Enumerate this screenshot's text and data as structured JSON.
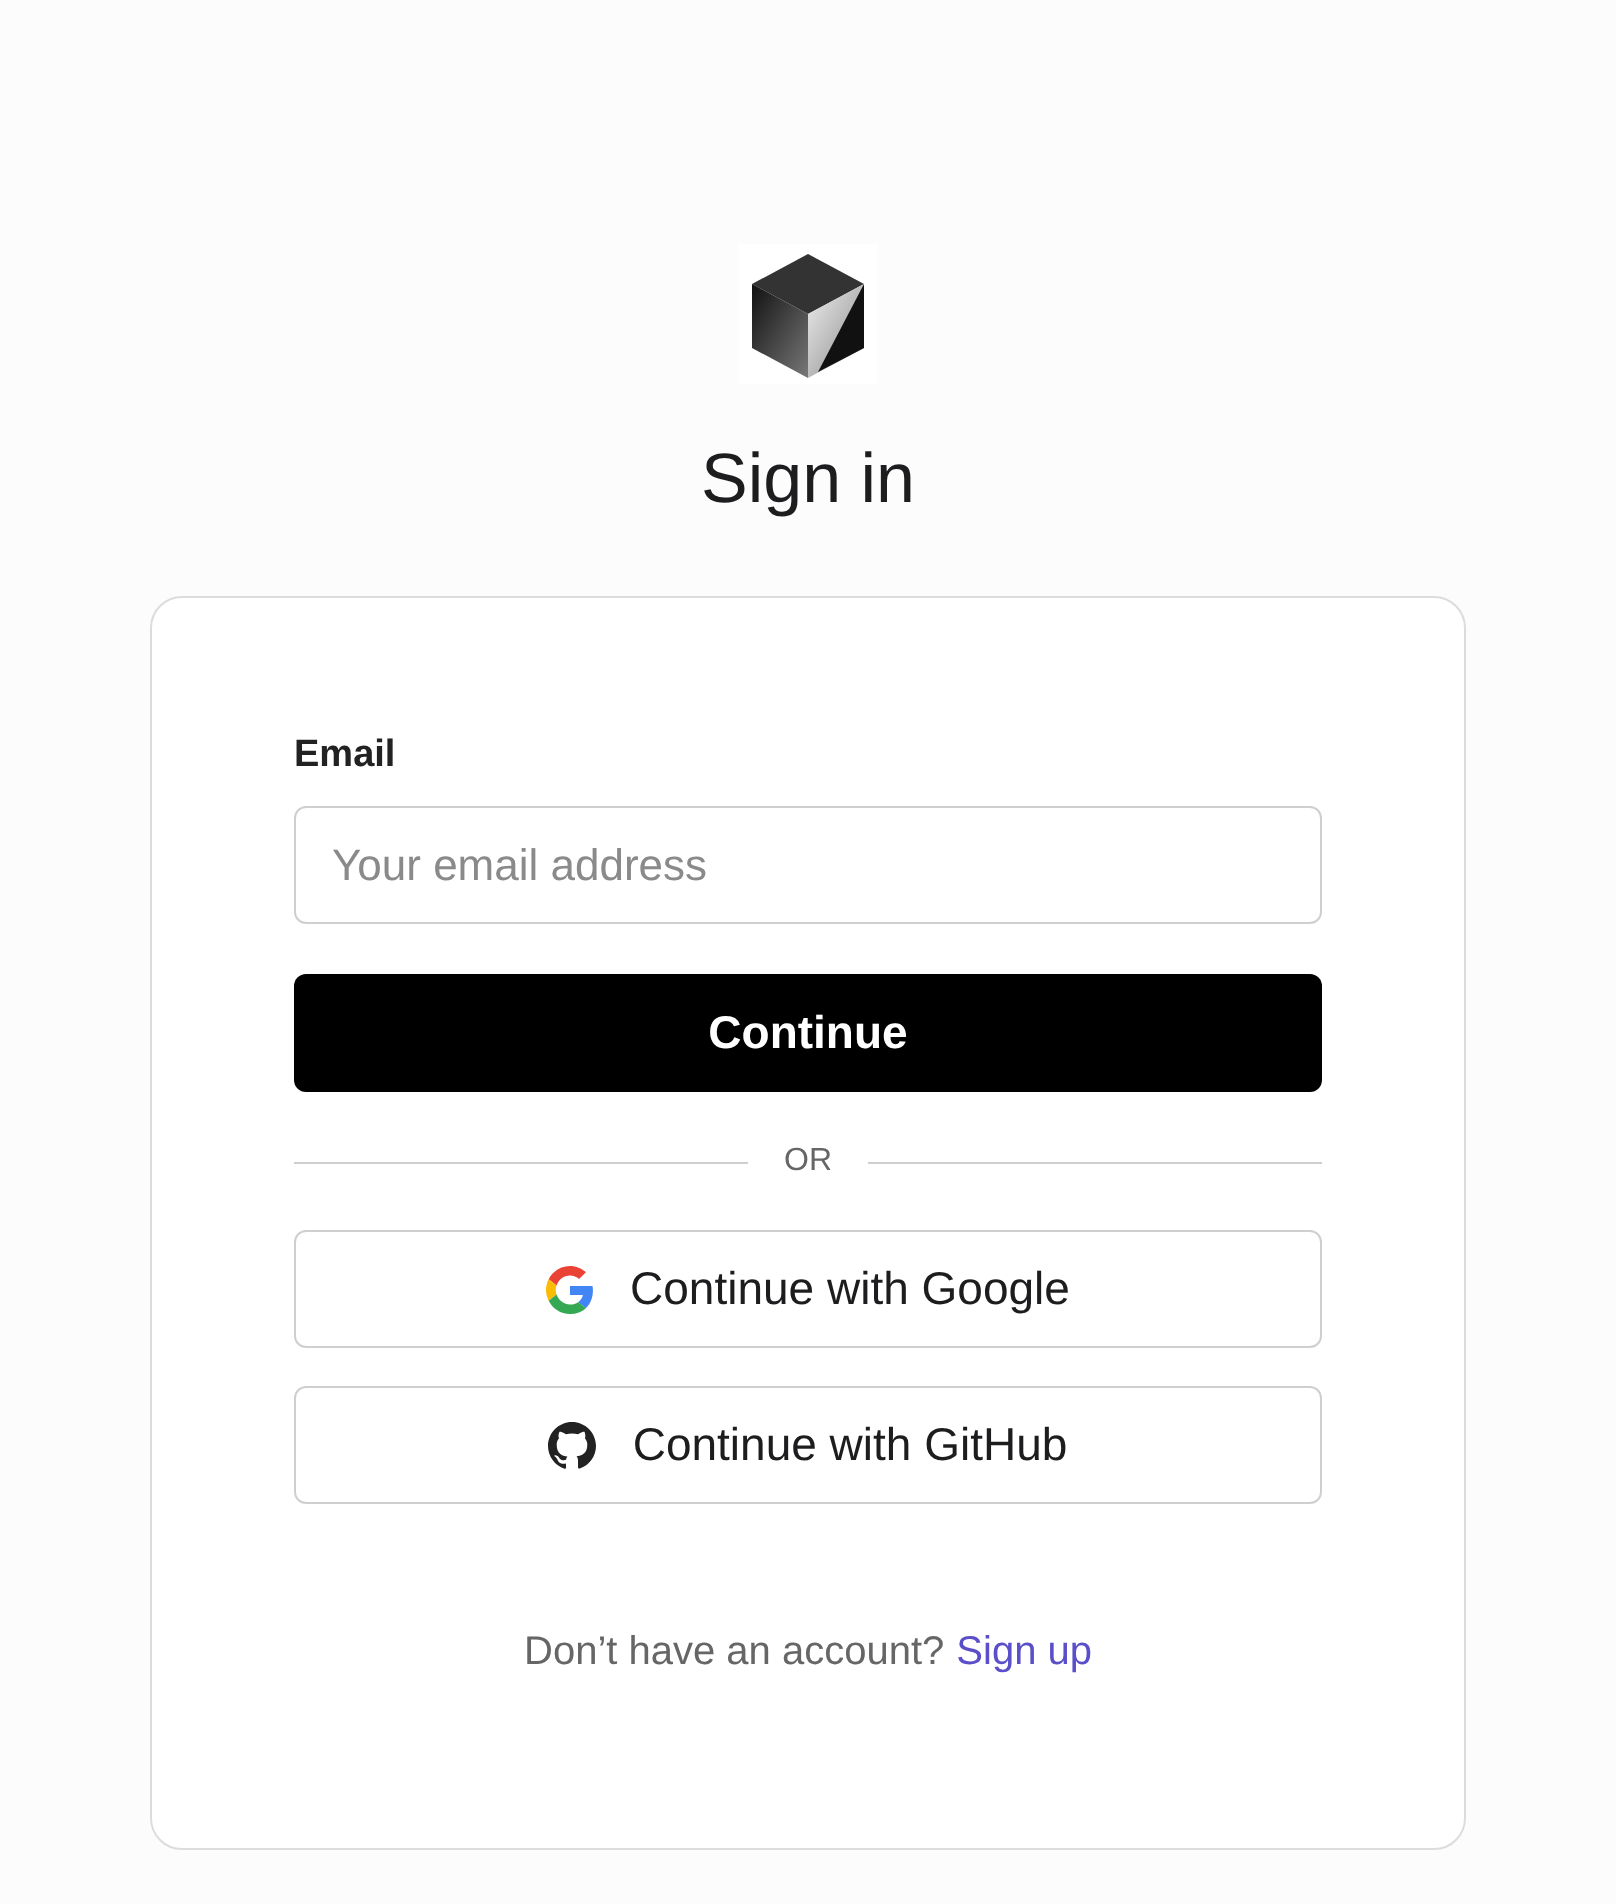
{
  "title": "Sign in",
  "form": {
    "email_label": "Email",
    "email": {
      "placeholder": "Your email address"
    },
    "continue_button": "Continue",
    "divider": "OR",
    "providers": [
      {
        "kind": "google",
        "label": "Continue with Google"
      },
      {
        "kind": "github",
        "label": "Continue with GitHub"
      }
    ],
    "footer": {
      "text": "Don’t have an account?",
      "link": "Sign up"
    }
  }
}
